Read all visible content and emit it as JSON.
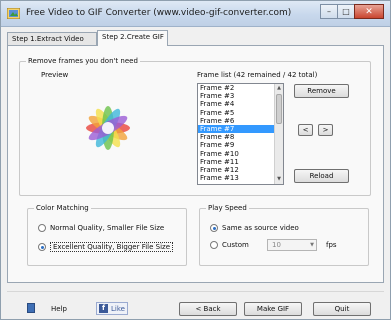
{
  "window": {
    "title": "Free Video to GIF Converter (www.video-gif-converter.com)",
    "minimize_glyph": "–",
    "maximize_glyph": "□",
    "close_glyph": "✕"
  },
  "tabs": [
    {
      "label": "Step 1.Extract Video",
      "active": false
    },
    {
      "label": "Step 2.Create GIF",
      "active": true
    }
  ],
  "remove_frames": {
    "group_title": "Remove frames you don't need",
    "preview_label": "Preview",
    "frame_list_label": "Frame list (42 remained / 42 total)",
    "frames": [
      "Frame #2",
      "Frame #3",
      "Frame #4",
      "Frame #5",
      "Frame #6",
      "Frame #7",
      "Frame #8",
      "Frame #9",
      "Frame #10",
      "Frame #11",
      "Frame #12",
      "Frame #13"
    ],
    "selected_frame": "Frame #7",
    "remove_label": "Remove",
    "prev_label": "<",
    "next_label": ">",
    "reload_label": "Reload"
  },
  "color_matching": {
    "group_title": "Color Matching",
    "option_normal": "Normal Quality, Smaller File Size",
    "option_excellent": "Excellent Quality, Bigger File Size",
    "selected": "excellent"
  },
  "play_speed": {
    "group_title": "Play Speed",
    "option_same": "Same as source video",
    "option_custom": "Custom",
    "custom_value": "10",
    "fps_label": "fps",
    "selected": "same"
  },
  "footer": {
    "help_label": "Help",
    "like_label": "Like",
    "fb_glyph": "f",
    "back_label": "< Back",
    "make_gif_label": "Make GIF",
    "quit_label": "Quit"
  },
  "colors": {
    "selection": "#3399ff",
    "radio_dot": "#2d6fc4",
    "facebook": "#3b5998"
  }
}
